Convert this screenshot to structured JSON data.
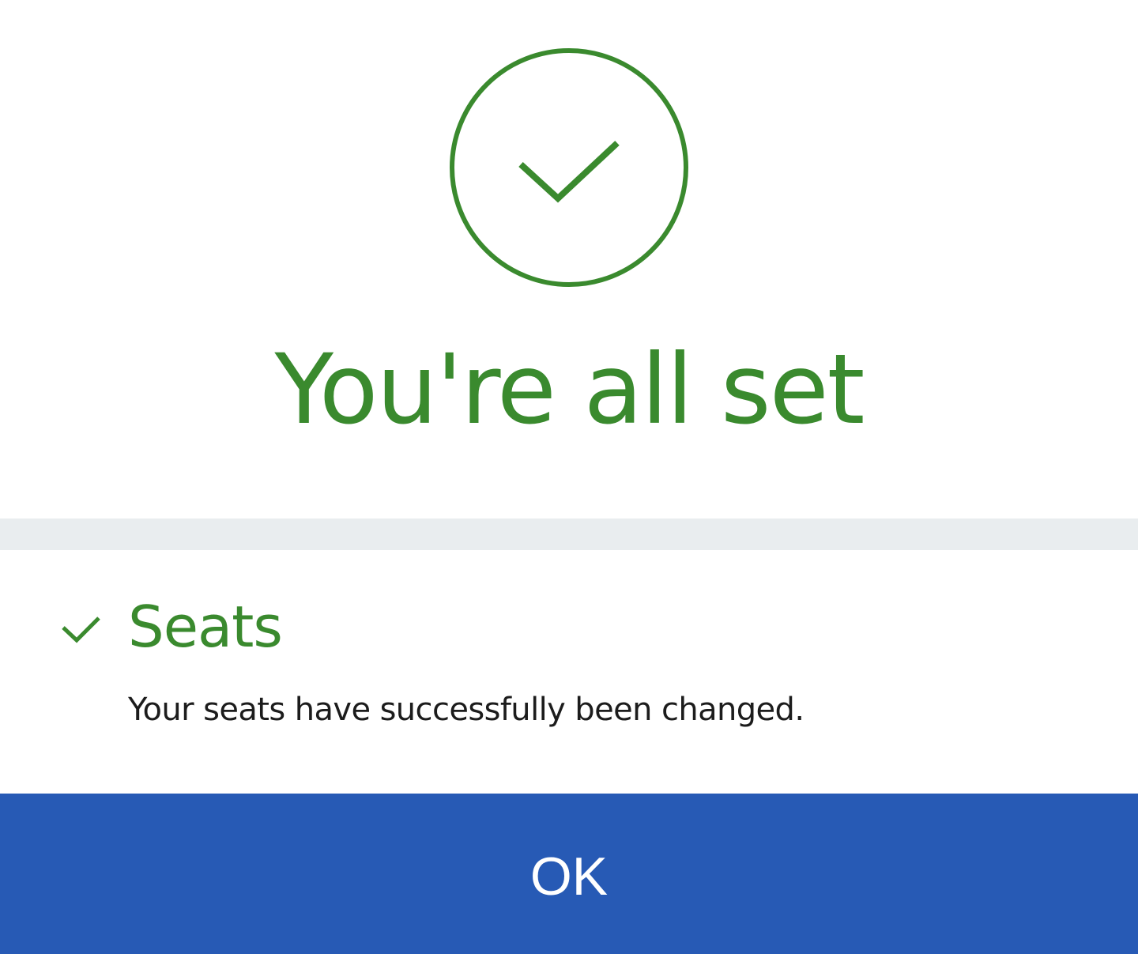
{
  "theme": {
    "success_color": "#3a8a2e",
    "divider_color": "#e9edef",
    "button_color": "#275ab5",
    "button_text_color": "#ffffff",
    "body_text_color": "#1c1c1c"
  },
  "hero": {
    "icon": "circle-check-icon",
    "title": "You're all set"
  },
  "section": {
    "icon": "check-icon",
    "title": "Seats",
    "message": "Your seats have successfully been changed."
  },
  "actions": {
    "ok_label": "OK"
  }
}
